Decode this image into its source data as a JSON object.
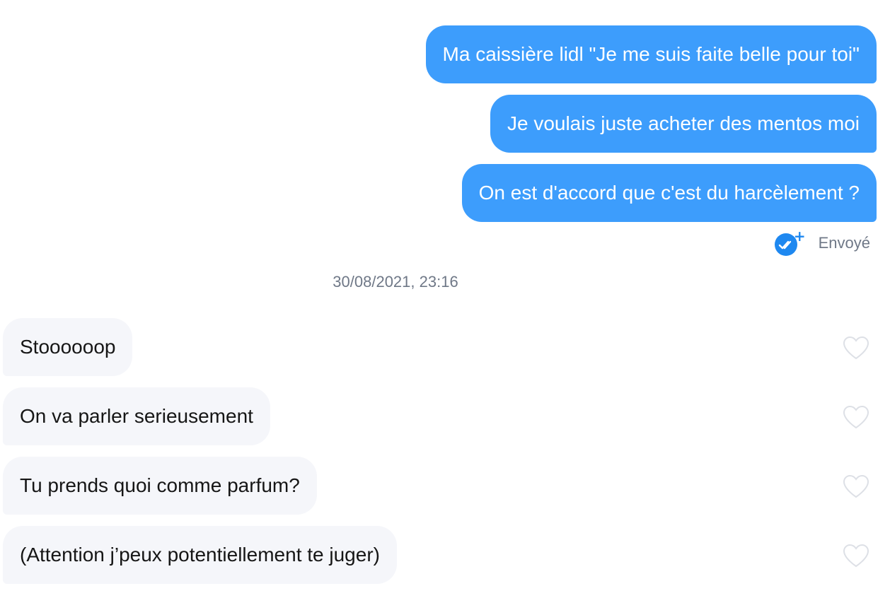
{
  "messages_sent": [
    {
      "text": "Ma caissière lidl \"Je me suis faite belle pour toi\""
    },
    {
      "text": "Je voulais juste acheter des mentos moi"
    },
    {
      "text": "On est d'accord que c'est du harcèlement ?"
    }
  ],
  "status": {
    "label": "Envoyé",
    "icon": "read-receipt-icon"
  },
  "timestamp": "30/08/2021, 23:16",
  "messages_received": [
    {
      "text": "Stoooooop"
    },
    {
      "text": "On va parler serieusement"
    },
    {
      "text": "Tu prends quoi comme parfum?"
    },
    {
      "text": "(Attention j’peux potentiellement te juger)"
    }
  ],
  "colors": {
    "sent_bubble": "#3d9dfc",
    "received_bubble": "#f5f6fa",
    "accent": "#1e88f0",
    "muted_text": "#6f7887"
  }
}
